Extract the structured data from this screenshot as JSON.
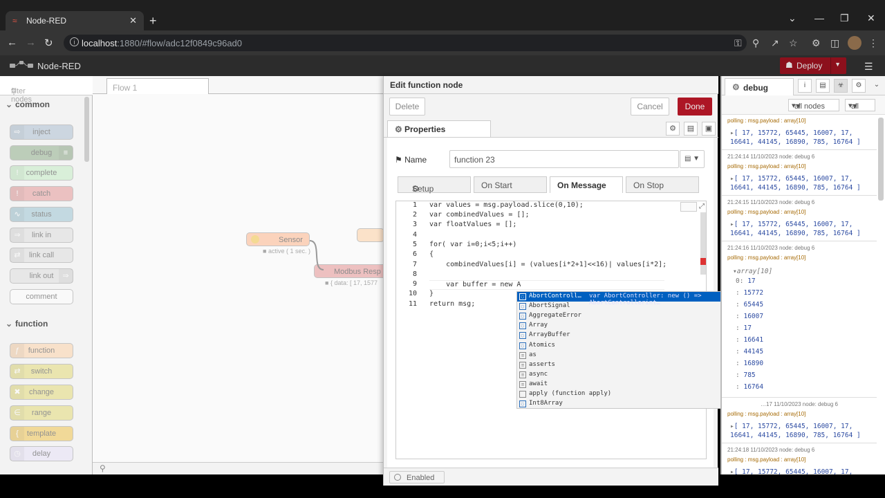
{
  "browser": {
    "tab_title": "Node-RED",
    "url_host": "localhost",
    "url_rest": ":1880/#flow/adc12f0849c96ad0"
  },
  "app": {
    "title": "Node-RED",
    "deploy_label": "Deploy"
  },
  "palette": {
    "filter_placeholder": "filter nodes",
    "categories": [
      {
        "label": "common",
        "nodes": [
          "inject",
          "debug",
          "complete",
          "catch",
          "status",
          "link in",
          "link call",
          "link out",
          "comment"
        ]
      },
      {
        "label": "function",
        "nodes": [
          "function",
          "switch",
          "change",
          "range",
          "template",
          "delay"
        ]
      }
    ],
    "colors": {
      "inject": "#a6bbcf",
      "debug": "#87a980",
      "complete": "#c0edc0",
      "catch": "#e49191",
      "status": "#94c1d0",
      "link": "#dddddd",
      "function": "#fdd0a2",
      "switch": "#e2d96e",
      "range": "#e2d96e",
      "template": "#f0c040",
      "delay": "#e6e0f8"
    }
  },
  "workspace": {
    "tab_label": "Flow 1",
    "nodes": [
      {
        "label": "Sensor",
        "status": "active ( 1 sec. )"
      },
      {
        "label": "Modbus Resp",
        "status": "{ data: [ 17, 1577"
      }
    ]
  },
  "tray": {
    "title": "Edit function node",
    "delete_label": "Delete",
    "cancel_label": "Cancel",
    "done_label": "Done",
    "properties_label": "Properties",
    "name_label": "Name",
    "name_value": "function 23",
    "tabs": [
      "Setup",
      "On Start",
      "On Message",
      "On Stop"
    ],
    "active_tab": "On Message",
    "enabled_label": "Enabled",
    "code_lines": [
      "var values = msg.payload.slice(0,10);",
      "var combinedValues = [];",
      "var floatValues = [];",
      "",
      "for( var i=0;i<5;i++)",
      "{",
      "    combinedValues[i] = (values[i*2+1]<<16)| values[i*2];",
      "",
      "    var buffer = new A",
      "}",
      "return msg;"
    ],
    "autocomplete": [
      {
        "label": "AbortControll…",
        "detail": "var AbortController: new () => AbortControllerint…"
      },
      {
        "label": "AbortSignal"
      },
      {
        "label": "AggregateError"
      },
      {
        "label": "Array"
      },
      {
        "label": "ArrayBuffer"
      },
      {
        "label": "Atomics"
      },
      {
        "label": "as"
      },
      {
        "label": "asserts"
      },
      {
        "label": "async"
      },
      {
        "label": "await"
      },
      {
        "label": "apply (function apply)"
      },
      {
        "label": "Int8Array"
      }
    ]
  },
  "sidebar": {
    "tab_label": "debug",
    "filter_nodes": "all nodes",
    "filter_all": "all",
    "messages": [
      {
        "meta": "",
        "topic": "polling : msg.payload : array[10]",
        "value": "[ 17, 15772, 65445, 16007, 17,\n16641, 44145, 16890, 785, 16764 ]"
      },
      {
        "meta": "21:24:14 11/10/2023   node: debug 6",
        "topic": "polling : msg.payload : array[10]",
        "value": "[ 17, 15772, 65445, 16007, 17,\n16641, 44145, 16890, 785, 16764 ]"
      },
      {
        "meta": "21:24:15 11/10/2023   node: debug 6",
        "topic": "polling : msg.payload : array[10]",
        "value": "[ 17, 15772, 65445, 16007, 17,\n16641, 44145, 16890, 785, 16764 ]"
      },
      {
        "meta": "21:24:16 11/10/2023   node: debug 6",
        "topic": "polling : msg.payload : array[10]",
        "value": "array[10]"
      },
      {
        "meta": "…17 11/10/2023   node: debug 6",
        "topic": "polling : msg.payload : array[10]",
        "value": "[ 17, 15772, 65445, 16007, 17,\n16641, 44145, 16890, 785, 16764 ]"
      },
      {
        "meta": "21:24:18 11/10/2023   node: debug 6",
        "topic": "polling : msg.payload : array[10]",
        "value": "[ 17, 15772, 65445, 16007, 17,"
      }
    ],
    "expanded": [
      {
        "k": "0:",
        "v": "17"
      },
      {
        "k": ":",
        "v": "15772"
      },
      {
        "k": ":",
        "v": "65445"
      },
      {
        "k": ":",
        "v": "16007"
      },
      {
        "k": ":",
        "v": "17"
      },
      {
        "k": ":",
        "v": "16641"
      },
      {
        "k": ":",
        "v": "44145"
      },
      {
        "k": ":",
        "v": "16890"
      },
      {
        "k": ":",
        "v": "785"
      },
      {
        "k": ":",
        "v": "16764"
      }
    ]
  }
}
